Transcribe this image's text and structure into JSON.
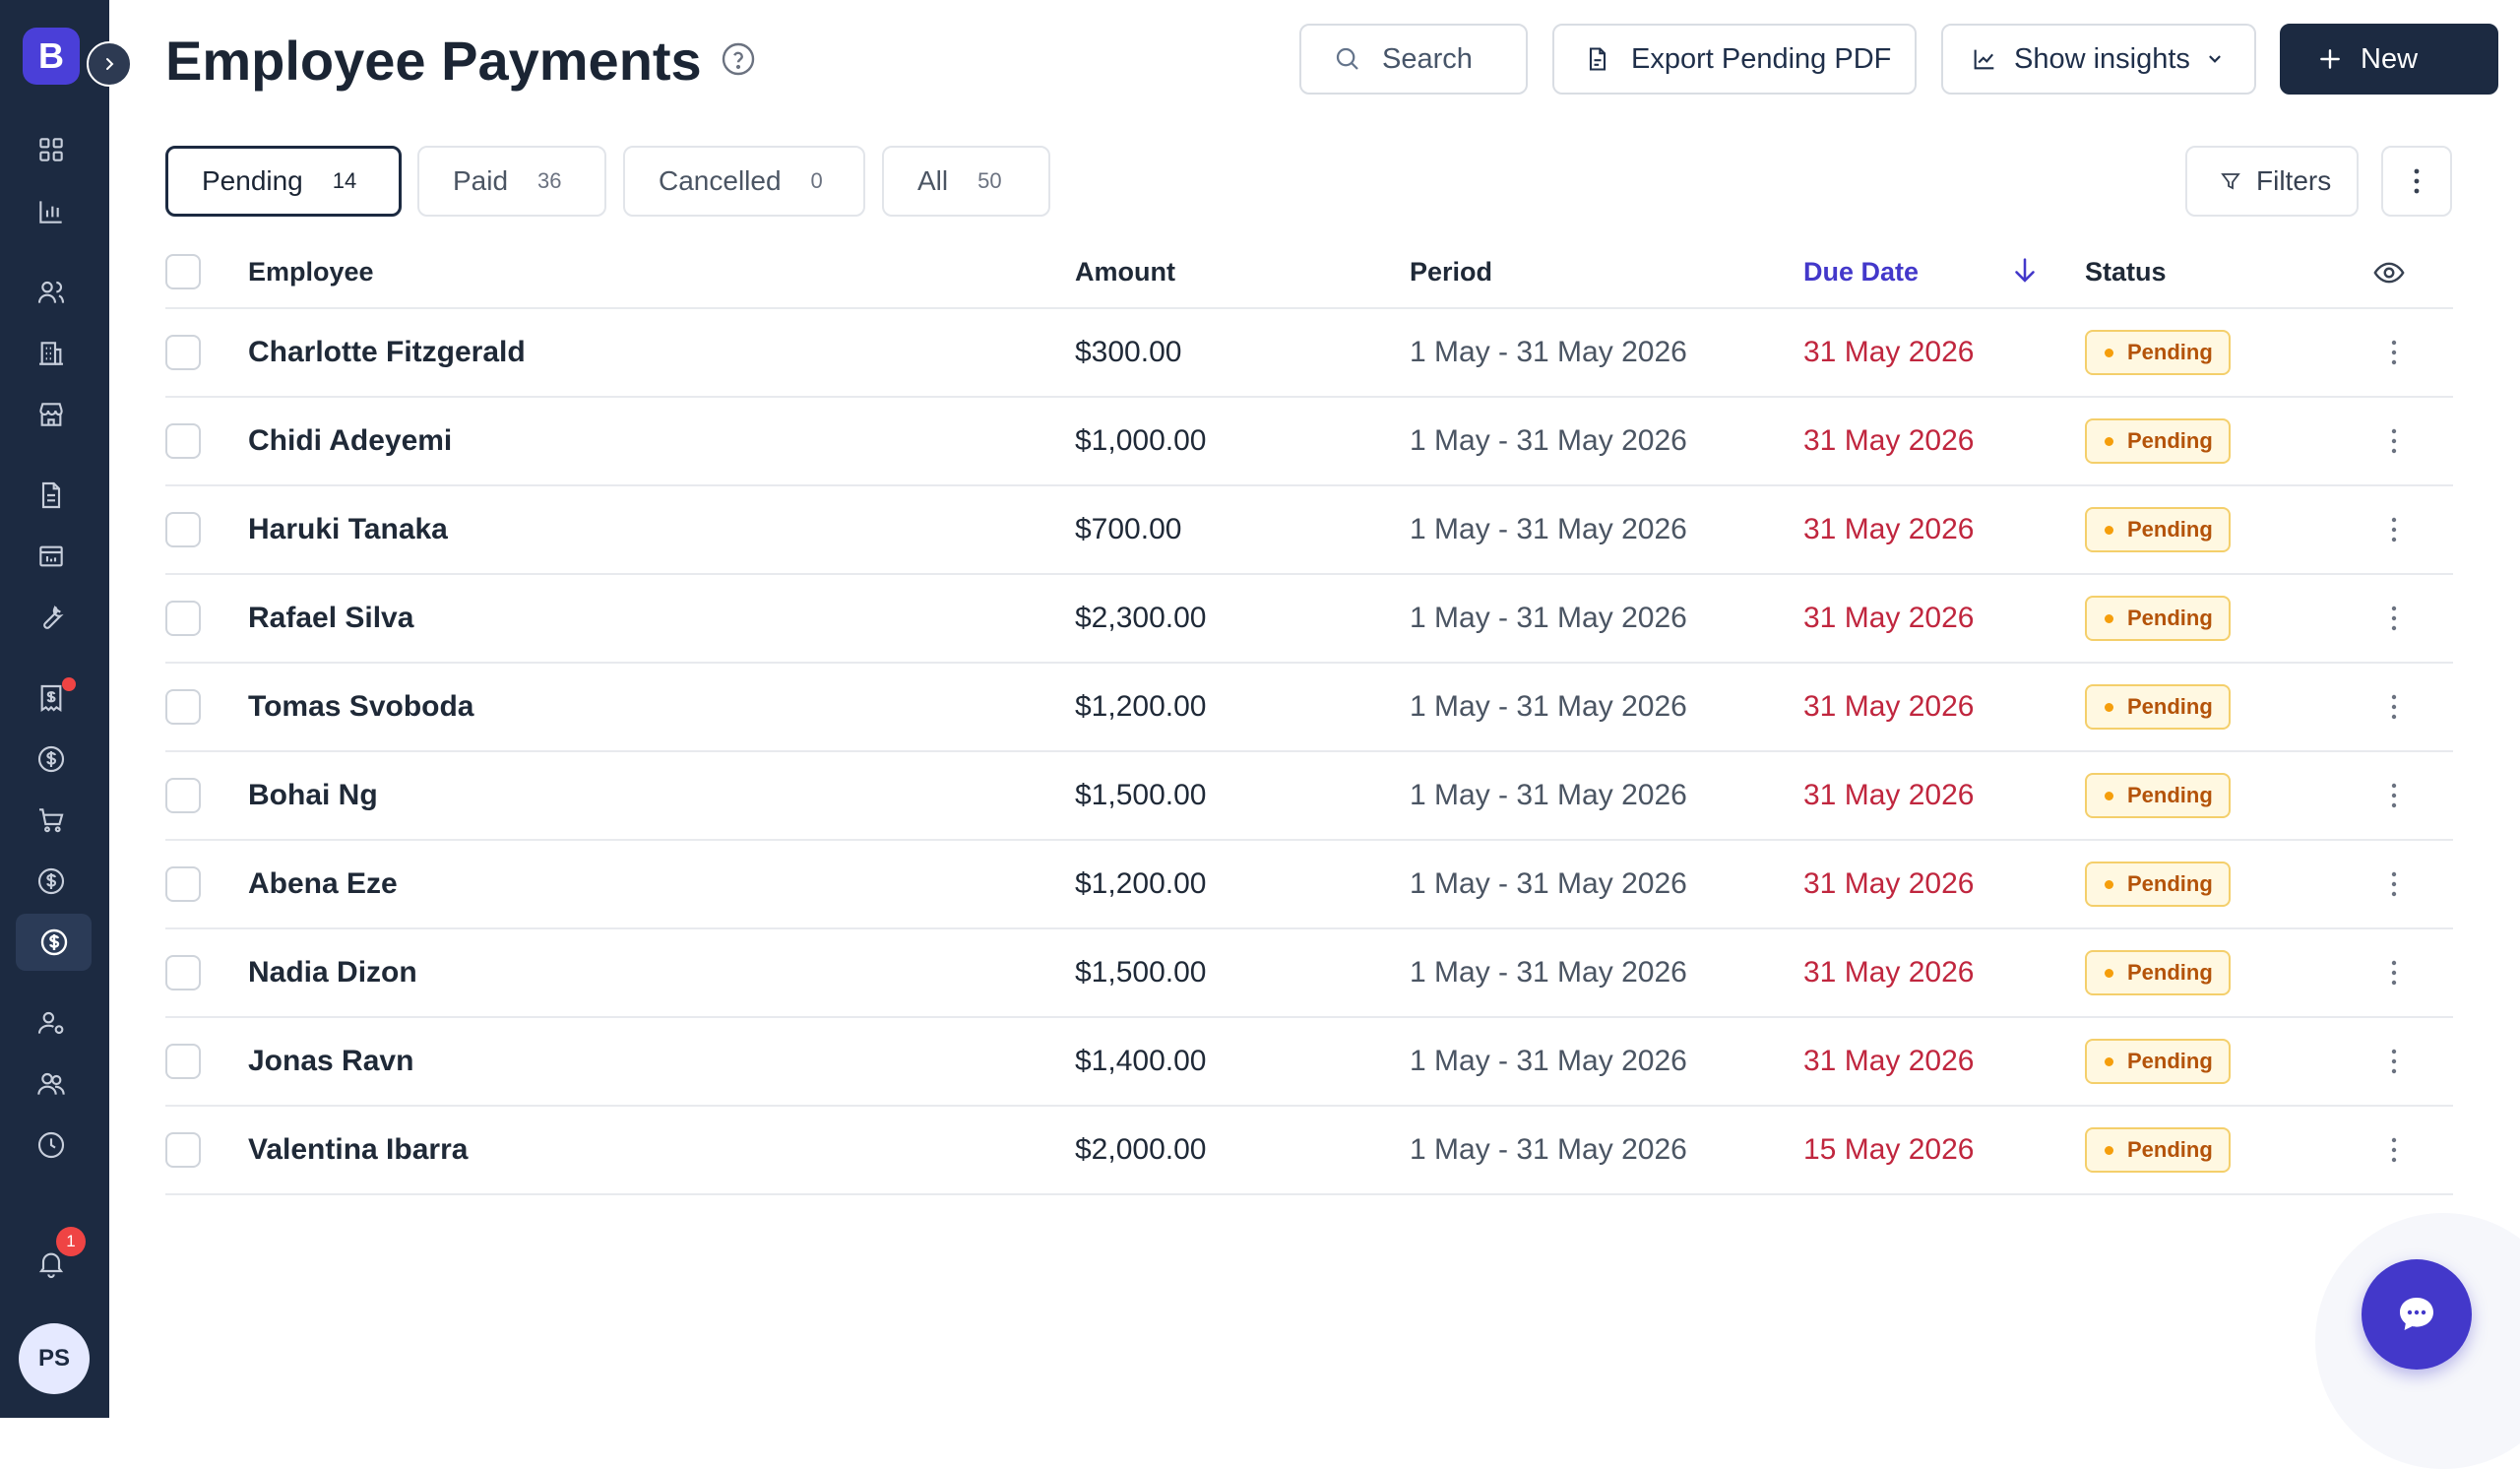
{
  "sidebar": {
    "logo_letter": "B",
    "avatar_initials": "PS",
    "notification_count": "1"
  },
  "header": {
    "title": "Employee Payments",
    "search_label": "Search",
    "export_label": "Export Pending PDF",
    "insights_label": "Show insights",
    "new_label": "New"
  },
  "tabs": [
    {
      "label": "Pending",
      "count": "14"
    },
    {
      "label": "Paid",
      "count": "36"
    },
    {
      "label": "Cancelled",
      "count": "0"
    },
    {
      "label": "All",
      "count": "50"
    }
  ],
  "toolbar": {
    "filters_label": "Filters"
  },
  "table": {
    "columns": {
      "employee": "Employee",
      "amount": "Amount",
      "period": "Period",
      "due_date": "Due Date",
      "status": "Status"
    },
    "rows": [
      {
        "employee": "Charlotte Fitzgerald",
        "amount": "$300.00",
        "period": "1 May - 31 May 2026",
        "due_date": "31 May 2026",
        "status": "Pending"
      },
      {
        "employee": "Chidi Adeyemi",
        "amount": "$1,000.00",
        "period": "1 May - 31 May 2026",
        "due_date": "31 May 2026",
        "status": "Pending"
      },
      {
        "employee": "Haruki Tanaka",
        "amount": "$700.00",
        "period": "1 May - 31 May 2026",
        "due_date": "31 May 2026",
        "status": "Pending"
      },
      {
        "employee": "Rafael Silva",
        "amount": "$2,300.00",
        "period": "1 May - 31 May 2026",
        "due_date": "31 May 2026",
        "status": "Pending"
      },
      {
        "employee": "Tomas Svoboda",
        "amount": "$1,200.00",
        "period": "1 May - 31 May 2026",
        "due_date": "31 May 2026",
        "status": "Pending"
      },
      {
        "employee": "Bohai Ng",
        "amount": "$1,500.00",
        "period": "1 May - 31 May 2026",
        "due_date": "31 May 2026",
        "status": "Pending"
      },
      {
        "employee": "Abena Eze",
        "amount": "$1,200.00",
        "period": "1 May - 31 May 2026",
        "due_date": "31 May 2026",
        "status": "Pending"
      },
      {
        "employee": "Nadia Dizon",
        "amount": "$1,500.00",
        "period": "1 May - 31 May 2026",
        "due_date": "31 May 2026",
        "status": "Pending"
      },
      {
        "employee": "Jonas Ravn",
        "amount": "$1,400.00",
        "period": "1 May - 31 May 2026",
        "due_date": "31 May 2026",
        "status": "Pending"
      },
      {
        "employee": "Valentina Ibarra",
        "amount": "$2,000.00",
        "period": "1 May - 31 May 2026",
        "due_date": "15 May 2026",
        "status": "Pending"
      }
    ]
  },
  "colors": {
    "sidebar_bg": "#1c2a41",
    "brand": "#4a3fd8",
    "due_date_text": "#c0263e",
    "pending_badge": "#b45309",
    "chat_button": "#4338ca"
  }
}
